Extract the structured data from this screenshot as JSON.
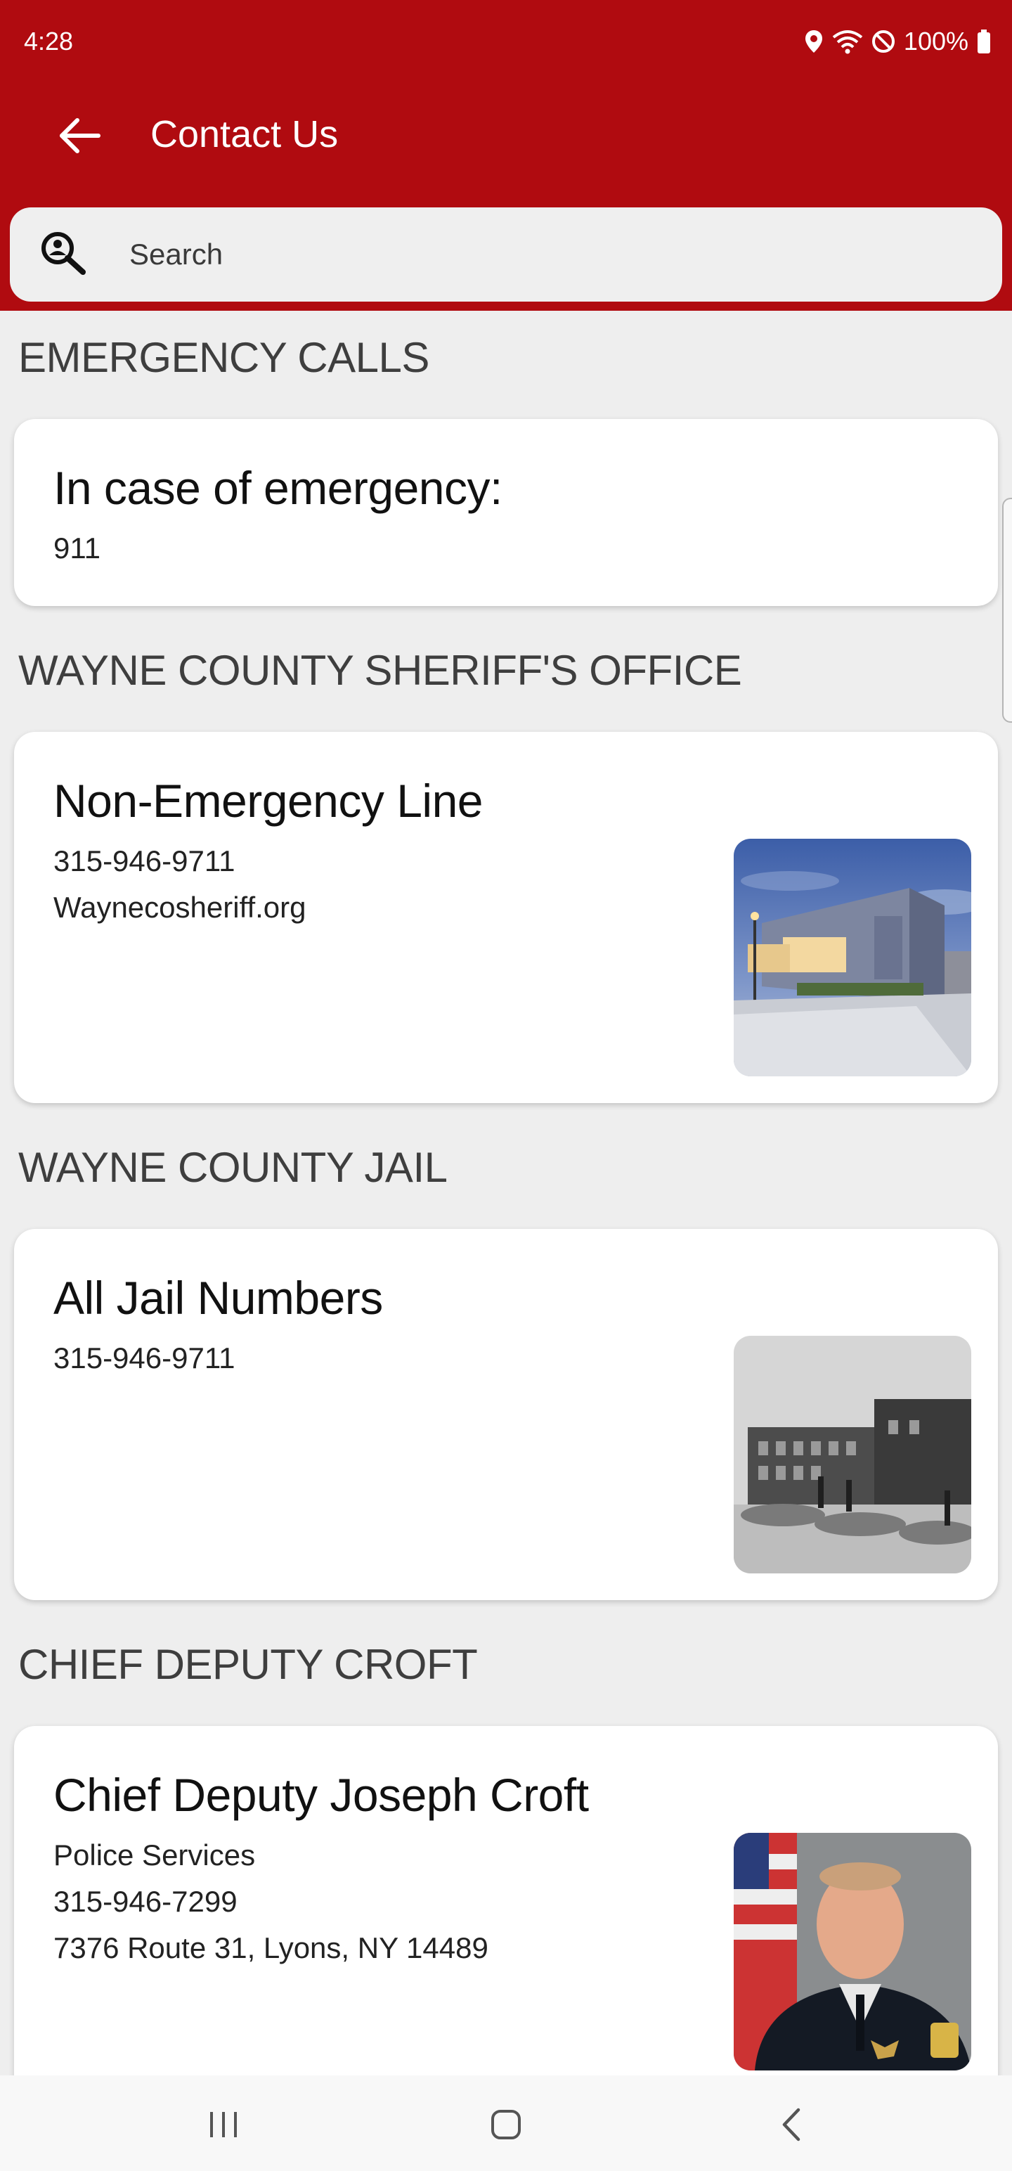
{
  "status_bar": {
    "time": "4:28",
    "battery": "100%"
  },
  "app_bar": {
    "title": "Contact Us"
  },
  "search": {
    "placeholder": "Search"
  },
  "sections": [
    {
      "title": "EMERGENCY CALLS",
      "card": {
        "title": "In case of emergency:",
        "lines": [
          "911"
        ]
      }
    },
    {
      "title": "WAYNE COUNTY SHERIFF'S OFFICE",
      "card": {
        "title": "Non-Emergency Line",
        "lines": [
          "315-946-9711",
          "Waynecosheriff.org"
        ],
        "image": "sheriff-office-building-photo"
      }
    },
    {
      "title": "WAYNE COUNTY JAIL",
      "card": {
        "title": "All Jail Numbers",
        "lines": [
          "315-946-9711"
        ],
        "image": "county-jail-historic-photo"
      }
    },
    {
      "title": "CHIEF DEPUTY CROFT",
      "card": {
        "title": "Chief Deputy Joseph Croft",
        "lines": [
          " Police Services",
          "315-946-7299",
          "7376 Route 31, Lyons, NY 14489"
        ],
        "image": "chief-deputy-portrait"
      }
    }
  ],
  "colors": {
    "header": "#b00b10",
    "background": "#eeeeee",
    "card": "#ffffff",
    "section_title": "#3e3e3e"
  },
  "nav": {
    "icons": [
      "recent-apps-icon",
      "home-icon",
      "back-icon"
    ]
  }
}
